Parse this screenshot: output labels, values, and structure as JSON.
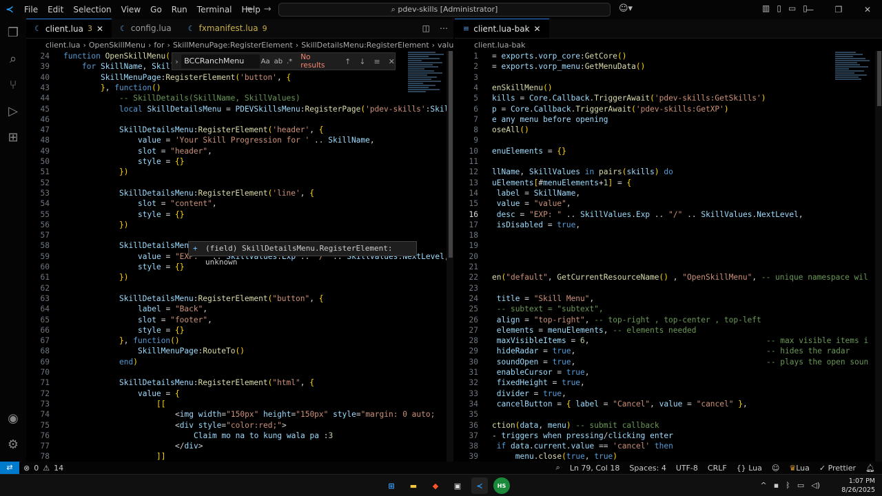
{
  "titlebar": {
    "menu": [
      "File",
      "Edit",
      "Selection",
      "View",
      "Go",
      "Run",
      "Terminal",
      "Help"
    ],
    "command_center": "pdev-skills [Administrator]"
  },
  "left_editor": {
    "tabs": [
      {
        "label": "client.lua",
        "badge": "3",
        "active": true
      },
      {
        "label": "config.lua",
        "badge": "",
        "active": false
      },
      {
        "label": "fxmanifest.lua",
        "badge": "9",
        "active": false
      }
    ],
    "breadcrumb": [
      "client.lua",
      "OpenSkillMenu",
      "for",
      "SkillMenuPage:RegisterElement",
      "SkillDetailsMenu:RegisterElement",
      "value"
    ],
    "find": {
      "query": "BCCRanchMenu",
      "result": "No results"
    },
    "hover": "(field) SkillDetailsMenu.RegisterElement: unknown",
    "lines": [
      {
        "n": "24",
        "t": "function OpenSkillMenu()"
      },
      {
        "n": "39",
        "t": "    for SkillName, Skill"
      },
      {
        "n": "40",
        "t": "        SkillMenuPage:RegisterElement('button', {"
      },
      {
        "n": "43",
        "t": "        }, function()"
      },
      {
        "n": "44",
        "t": "            -- SkillDetails(SkillName, SkillValues)"
      },
      {
        "n": "45",
        "t": "            local SkillDetailsMenu = PDEVSkillsMenu:RegisterPage('pdev-skills':SkillName)"
      },
      {
        "n": "46",
        "t": ""
      },
      {
        "n": "47",
        "t": "            SkillDetailsMenu:RegisterElement('header', {"
      },
      {
        "n": "48",
        "t": "                value = 'Your Skill Progression for ' .. SkillName,"
      },
      {
        "n": "49",
        "t": "                slot = \"header\","
      },
      {
        "n": "50",
        "t": "                style = {}"
      },
      {
        "n": "51",
        "t": "            })"
      },
      {
        "n": "52",
        "t": ""
      },
      {
        "n": "53",
        "t": "            SkillDetailsMenu:RegisterElement('line', {"
      },
      {
        "n": "54",
        "t": "                slot = \"content\","
      },
      {
        "n": "55",
        "t": "                style = {}"
      },
      {
        "n": "56",
        "t": "            })"
      },
      {
        "n": "57",
        "t": ""
      },
      {
        "n": "58",
        "t": "            SkillDetailsMenu:RegisterElement('header', {"
      },
      {
        "n": "59",
        "t": "                value = \"EXP: \" .. SkillValues.Exp .. \"/\" .. SkillValues.NextLevel,"
      },
      {
        "n": "60",
        "t": "                style = {}"
      },
      {
        "n": "61",
        "t": "            })"
      },
      {
        "n": "62",
        "t": ""
      },
      {
        "n": "63",
        "t": "            SkillDetailsMenu:RegisterElement(\"button\", {"
      },
      {
        "n": "64",
        "t": "                label = \"Back\","
      },
      {
        "n": "65",
        "t": "                slot = \"footer\","
      },
      {
        "n": "66",
        "t": "                style = {}"
      },
      {
        "n": "67",
        "t": "            }, function()"
      },
      {
        "n": "68",
        "t": "                SkillMenuPage:RouteTo()"
      },
      {
        "n": "69",
        "t": "            end)"
      },
      {
        "n": "70",
        "t": ""
      },
      {
        "n": "71",
        "t": "            SkillDetailsMenu:RegisterElement(\"html\", {"
      },
      {
        "n": "72",
        "t": "                value = {"
      },
      {
        "n": "73",
        "t": "                    [["
      },
      {
        "n": "74",
        "t": "                        <img width=\"150px\" height=\"150px\" style=\"margin: 0 auto;"
      },
      {
        "n": "75",
        "t": "                        <div style=\"color:red;\">"
      },
      {
        "n": "76",
        "t": "                            Claim mo na to kung wala pa :3"
      },
      {
        "n": "77",
        "t": "                        </div>"
      },
      {
        "n": "78",
        "t": "                    ]]"
      }
    ]
  },
  "right_editor": {
    "tabs": [
      {
        "label": "client.lua-bak",
        "active": true
      }
    ],
    "breadcrumb": [
      "client.lua-bak"
    ],
    "lines": [
      {
        "n": "1",
        "t": "= exports.vorp_core:GetCore()"
      },
      {
        "n": "2",
        "t": "= exports.vorp_menu:GetMenuData()"
      },
      {
        "n": "3",
        "t": ""
      },
      {
        "n": "4",
        "t": "enSkillMenu()"
      },
      {
        "n": "5",
        "t": "kills = Core.Callback.TriggerAwait('pdev-skills:GetSkills')"
      },
      {
        "n": "6",
        "t": "p = Core.Callback.TriggerAwait('pdev-skills:GetXP')"
      },
      {
        "n": "7",
        "t": "e any menu before opening"
      },
      {
        "n": "8",
        "t": "oseAll()"
      },
      {
        "n": "9",
        "t": ""
      },
      {
        "n": "10",
        "t": "enuElements = {}"
      },
      {
        "n": "11",
        "t": ""
      },
      {
        "n": "12",
        "t": "llName, SkillValues in pairs(skills) do"
      },
      {
        "n": "13",
        "t": "uElements[#menuElements+1] = {"
      },
      {
        "n": "14",
        "t": " label = SkillName,"
      },
      {
        "n": "15",
        "t": " value = \"value\","
      },
      {
        "n": "16",
        "t": " desc = \"EXP: \" .. SkillValues.Exp .. \"/\" .. SkillValues.NextLevel,"
      },
      {
        "n": "17",
        "t": " isDisabled = true,"
      },
      {
        "n": "18",
        "t": ""
      },
      {
        "n": "19",
        "t": ""
      },
      {
        "n": "20",
        "t": ""
      },
      {
        "n": "21",
        "t": ""
      },
      {
        "n": "22",
        "t": "en(\"default\", GetCurrentResourceName() , \"OpenSkillMenu\", -- unique namespace wil"
      },
      {
        "n": "23",
        "t": ""
      },
      {
        "n": "24",
        "t": " title = \"Skill Menu\","
      },
      {
        "n": "25",
        "t": " -- subtext = \"subtext\","
      },
      {
        "n": "26",
        "t": " align = \"top-right\", -- top-right , top-center , top-left"
      },
      {
        "n": "27",
        "t": " elements = menuElements, -- elements needed"
      },
      {
        "n": "28",
        "t": " maxVisibleItems = 6,                                      -- max visible items i"
      },
      {
        "n": "29",
        "t": " hideRadar = true,                                         -- hides the radar"
      },
      {
        "n": "30",
        "t": " soundOpen = true,                                         -- plays the open soun"
      },
      {
        "n": "31",
        "t": " enableCursor = true,"
      },
      {
        "n": "32",
        "t": " fixedHeight = true,"
      },
      {
        "n": "33",
        "t": " divider = true,"
      },
      {
        "n": "34",
        "t": " cancelButton = { label = \"Cancel\", value = \"cancel\" },"
      },
      {
        "n": "35",
        "t": ""
      },
      {
        "n": "36",
        "t": "ction(data, menu) -- submit callback"
      },
      {
        "n": "37",
        "t": "- triggers when pressing/clicking enter"
      },
      {
        "n": "38",
        "t": " if data.current.value == 'cancel' then"
      },
      {
        "n": "39",
        "t": "     menu.close(true, true)"
      }
    ]
  },
  "statusbar": {
    "errors": "0",
    "warnings": "14",
    "position": "Ln 79, Col 18",
    "spaces": "Spaces: 4",
    "encoding": "UTF-8",
    "eol": "CRLF",
    "language": "Lua",
    "lua": "Lua",
    "prettier": "Prettier"
  },
  "taskbar": {
    "time": "1:07 PM",
    "date": "8/26/2025"
  }
}
